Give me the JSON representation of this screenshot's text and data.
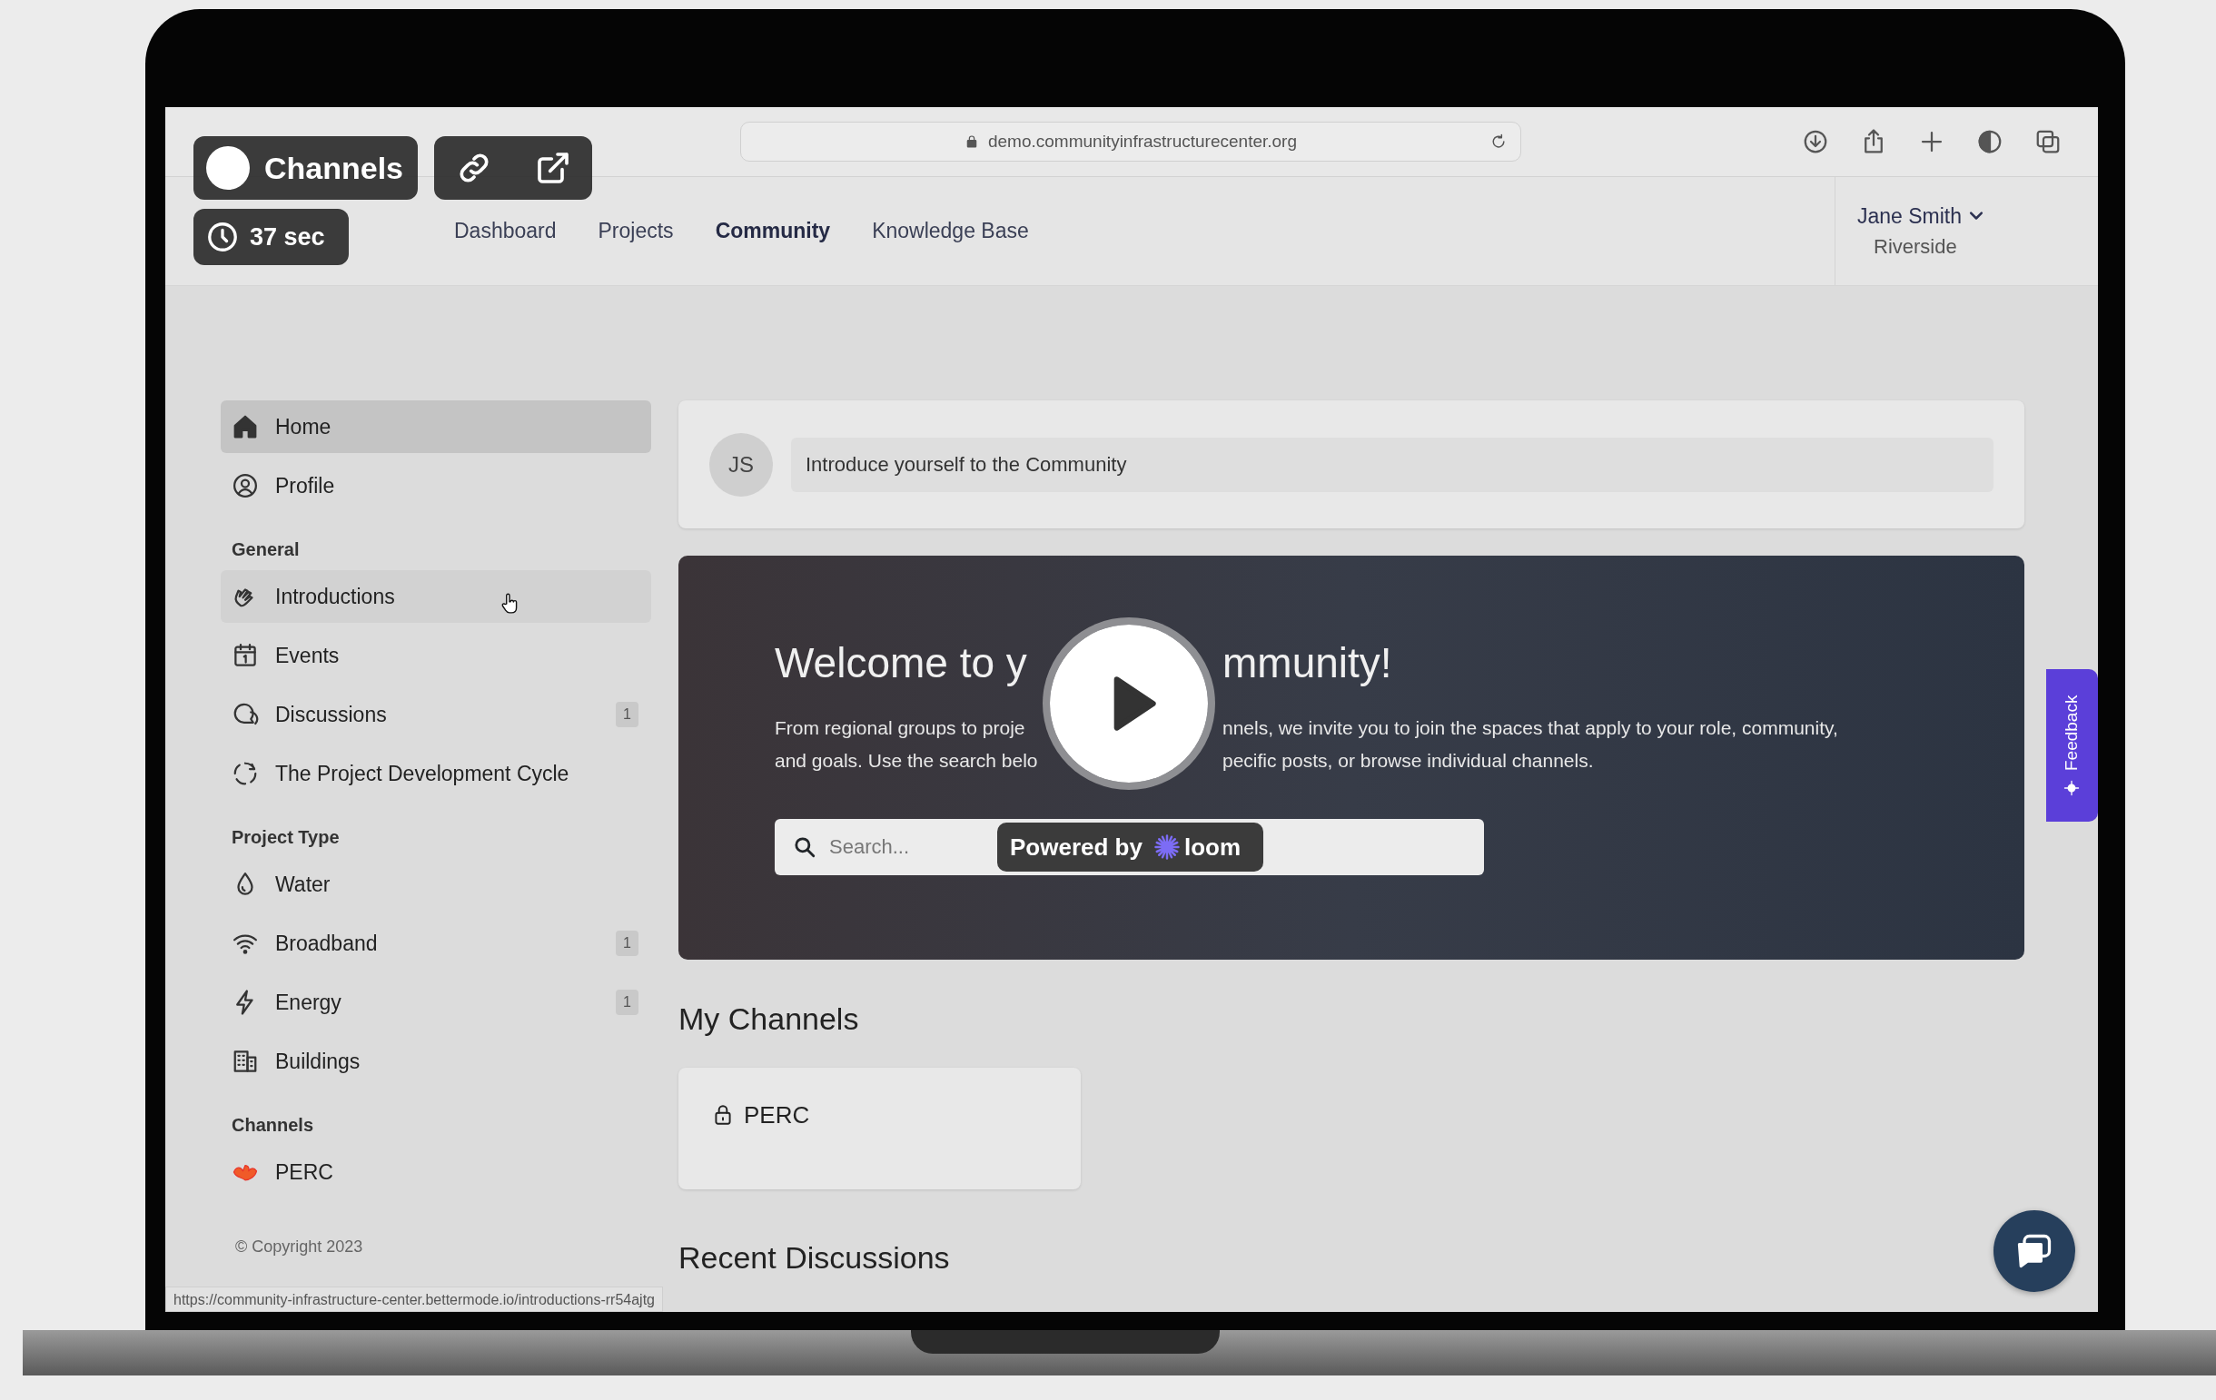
{
  "browser": {
    "url": "demo.communityinfrastructurecenter.org",
    "status_url": "https://community-infrastructure-center.bettermode.io/introductions-rr54ajtg"
  },
  "nav": {
    "links": [
      {
        "label": "Dashboard",
        "selected": false
      },
      {
        "label": "Projects",
        "selected": false
      },
      {
        "label": "Community",
        "selected": true
      },
      {
        "label": "Knowledge Base",
        "selected": false
      }
    ],
    "user": {
      "name": "Jane Smith",
      "location": "Riverside"
    }
  },
  "sidebar": {
    "groups": [
      {
        "items": [
          {
            "label": "Home",
            "selected": true,
            "hovered": false
          },
          {
            "label": "Profile",
            "selected": false,
            "hovered": false
          }
        ]
      },
      {
        "title": "General",
        "items": [
          {
            "label": "Introductions",
            "selected": false,
            "hovered": true
          },
          {
            "label": "Events",
            "selected": false,
            "hovered": false
          },
          {
            "label": "Discussions",
            "badge": "1",
            "selected": false,
            "hovered": false
          },
          {
            "label": "The Project Development Cycle",
            "selected": false,
            "hovered": false
          }
        ]
      },
      {
        "title": "Project Type",
        "items": [
          {
            "label": "Water",
            "selected": false,
            "hovered": false
          },
          {
            "label": "Broadband",
            "badge": "1",
            "selected": false,
            "hovered": false
          },
          {
            "label": "Energy",
            "badge": "1",
            "selected": false,
            "hovered": false
          },
          {
            "label": "Buildings",
            "selected": false,
            "hovered": false
          }
        ]
      },
      {
        "title": "Channels",
        "items": [
          {
            "label": "PERC",
            "selected": false,
            "hovered": false
          }
        ]
      }
    ],
    "copyright": "© Copyright 2023"
  },
  "composer": {
    "avatar": "JS",
    "placeholder": "Introduce yourself to the Community"
  },
  "hero": {
    "title_parts": [
      "Welcome to y",
      "mmunity!"
    ],
    "text_lines": [
      [
        "From regional groups to proje",
        "nnels, we invite you to join the spaces that apply to your role, community,"
      ],
      [
        "and goals. Use the search belo",
        "pecific posts, or browse individual channels."
      ]
    ],
    "search": {
      "placeholder": "Search..."
    }
  },
  "my_channels": {
    "title": "My Channels",
    "channels": [
      {
        "name": "PERC",
        "locked": true
      }
    ]
  },
  "recent_discussions": {
    "title": "Recent Discussions"
  },
  "feedback": {
    "label": "Feedback"
  },
  "loom": {
    "title": "Channels",
    "timer": "37 sec",
    "powered_by": "Powered by",
    "brand": "loom"
  }
}
